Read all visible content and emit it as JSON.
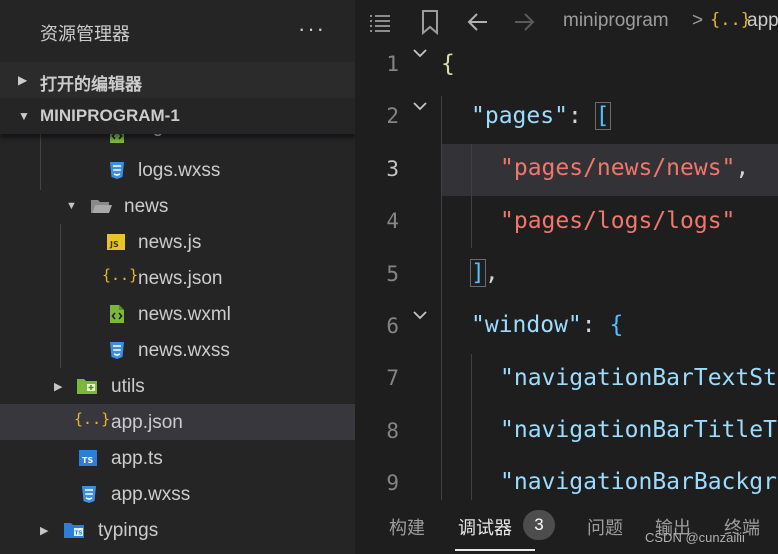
{
  "explorer": {
    "title": "资源管理器",
    "more": "···",
    "section_open_editors": "打开的编辑器",
    "section_project": "MINIPROGRAM-1",
    "tree": [
      {
        "name": "logs.wxml",
        "icon": "wxml-file-icon"
      },
      {
        "name": "logs.wxss",
        "icon": "wxss-file-icon"
      },
      {
        "name": "news",
        "icon": "folder-open-icon",
        "expanded": true
      },
      {
        "name": "news.js",
        "icon": "js-file-icon"
      },
      {
        "name": "news.json",
        "icon": "json-file-icon"
      },
      {
        "name": "news.wxml",
        "icon": "wxml-file-icon"
      },
      {
        "name": "news.wxss",
        "icon": "wxss-file-icon"
      },
      {
        "name": "utils",
        "icon": "folder-icon",
        "expanded": false
      },
      {
        "name": "app.json",
        "icon": "json-file-icon",
        "selected": true
      },
      {
        "name": "app.ts",
        "icon": "ts-file-icon"
      },
      {
        "name": "app.wxss",
        "icon": "wxss-file-icon"
      },
      {
        "name": "typings",
        "icon": "folder-icon",
        "expanded": false
      }
    ]
  },
  "editor": {
    "breadcrumb_folder": "miniprogram",
    "breadcrumb_separator": ">",
    "breadcrumb_json_icon": "{..}",
    "breadcrumb_file": "app.json",
    "line_numbers": [
      "1",
      "2",
      "3",
      "4",
      "5",
      "6",
      "7",
      "8",
      "9"
    ],
    "active_line": "3",
    "code": {
      "l1_brace": "{",
      "l2_key": "\"pages\"",
      "l2_colon": ": ",
      "l2_bracket": "[",
      "l3_value": "\"pages/news/news\"",
      "l3_comma": ",",
      "l4_value": "\"pages/logs/logs\"",
      "l5_bracket": "]",
      "l5_comma": ",",
      "l6_key": "\"window\"",
      "l6_colon": ": ",
      "l6_brace": "{",
      "l7_text": "\"navigationBarTextSt",
      "l8_text": "\"navigationBarTitleT",
      "l9_text": "\"navigationBarBackgr"
    }
  },
  "panel": {
    "tabs": [
      "构建",
      "调试器",
      "问题",
      "输出",
      "终端"
    ],
    "active_tab": "调试器",
    "debugger_badge": "3"
  },
  "watermark": "CSDN @cunzaiiii",
  "colors": {
    "sidebar_bg": "#252526",
    "editor_bg": "#1e1e1e",
    "selected_row": "#37373d",
    "string": "#f0776c",
    "key": "#9cdcfe",
    "json_icon": "#e8b824",
    "wxss_icon": "#3f8fe0",
    "wxml_icon": "#7bb73a",
    "ts_icon": "#2b7fd6"
  }
}
